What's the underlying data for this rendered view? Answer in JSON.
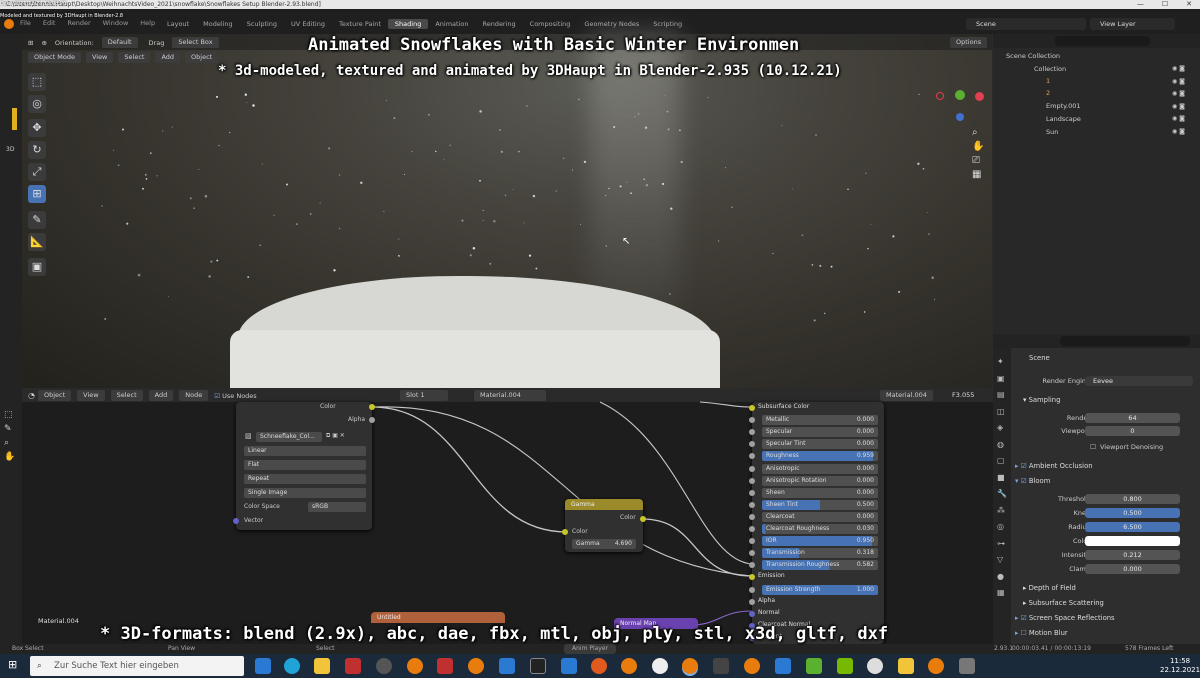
{
  "titlebar": {
    "line1": "Date 2021/12/22 13:08:20",
    "line2": "C:\\Users\\Dennis.Haupt\\Desktop\\WeihnachtsVideo_2021\\snowflake\\Snowflakes Setup Blender-2.93.blend]",
    "line3": "Modeled and textured by 3DHaupt in Blender-2.8"
  },
  "menubar": {
    "items": [
      "File",
      "Edit",
      "Render",
      "Window",
      "Help"
    ],
    "tabs": [
      "Layout",
      "Modeling",
      "Sculpting",
      "UV Editing",
      "Texture Paint",
      "Shading",
      "Animation",
      "Rendering",
      "Compositing",
      "Geometry Nodes",
      "Scripting"
    ],
    "active_tab": "Shading",
    "scene": "Scene",
    "view_layer": "View Layer"
  },
  "viewport": {
    "orientation_label": "Orientation:",
    "orientation": "Default",
    "drag_label": "Drag",
    "drag": "Select Box",
    "mode": "Object Mode",
    "menu": [
      "View",
      "Select",
      "Add",
      "Object"
    ],
    "options": "Options",
    "side_label": "3D"
  },
  "overlay": {
    "title": "Animated Snowflakes with Basic Winter Environmen",
    "subtitle": "* 3d-modeled, textured and animated by 3DHaupt in Blender-2.935 (10.12.21)",
    "formats": "* 3D-formats: blend (2.9x), abc, dae, fbx, mtl, obj, ply, stl, x3d, gltf, dxf"
  },
  "outliner": {
    "root": "Scene Collection",
    "items": [
      "Collection",
      "1",
      "2",
      "Empty.001",
      "Landscape",
      "Sun"
    ]
  },
  "properties": {
    "scene": "Scene",
    "render_engine_label": "Render Engine",
    "render_engine": "Eevee",
    "sampling": "Sampling",
    "render_label": "Render",
    "render_val": "64",
    "viewport_label": "Viewport",
    "viewport_val": "0",
    "denoise": "Viewport Denoising",
    "ao": "Ambient Occlusion",
    "bloom": "Bloom",
    "threshold_label": "Threshold",
    "threshold": "0.800",
    "knee_label": "Knee",
    "knee": "0.500",
    "radius_label": "Radius",
    "radius": "6.500",
    "color_label": "Color",
    "intensity_label": "Intensity",
    "intensity": "0.212",
    "clamp_label": "Clamp",
    "clamp": "0.000",
    "dof": "Depth of Field",
    "sss": "Subsurface Scattering",
    "ssr": "Screen Space Reflections",
    "motion_blur": "Motion Blur"
  },
  "node_editor": {
    "mode": "Object",
    "menu": [
      "View",
      "Select",
      "Add",
      "Node"
    ],
    "use_nodes": "Use Nodes",
    "slot": "Slot 1",
    "material": "Material.004",
    "frame": "F3.055",
    "material_label": "Material.004",
    "image_node": {
      "out_color": "Color",
      "out_alpha": "Alpha",
      "image": "Schneeflake_Col...",
      "interp": "Linear",
      "proj": "Flat",
      "ext": "Repeat",
      "source": "Single Image",
      "cs_label": "Color Space",
      "cs": "sRGB",
      "vector": "Vector"
    },
    "gamma_node": {
      "title": "Gamma",
      "out": "Color",
      "in": "Color",
      "gamma_label": "Gamma",
      "gamma": "4.690"
    },
    "untitled": "Untitled",
    "normal_map": "Normal Map",
    "bsdf": [
      [
        "Subsurface Color",
        ""
      ],
      [
        "Metallic",
        "0.000"
      ],
      [
        "Specular",
        "0.000"
      ],
      [
        "Specular Tint",
        "0.000"
      ],
      [
        "Roughness",
        "0.959"
      ],
      [
        "Anisotropic",
        "0.000"
      ],
      [
        "Anisotropic Rotation",
        "0.000"
      ],
      [
        "Sheen",
        "0.000"
      ],
      [
        "Sheen Tint",
        "0.500"
      ],
      [
        "Clearcoat",
        "0.000"
      ],
      [
        "Clearcoat Roughness",
        "0.030"
      ],
      [
        "IOR",
        "0.950"
      ],
      [
        "Transmission",
        "0.318"
      ],
      [
        "Transmission Roughness",
        "0.582"
      ],
      [
        "Emission",
        ""
      ],
      [
        "Emission Strength",
        "1.000"
      ],
      [
        "Alpha",
        ""
      ],
      [
        "Normal",
        ""
      ],
      [
        "Clearcoat Normal",
        ""
      ],
      [
        "Tangent",
        ""
      ]
    ]
  },
  "statusbar": {
    "left": "Box Select",
    "pan": "Pan View",
    "select": "Select",
    "anim": "Anim Player",
    "version": "2.93.1",
    "time": "00:00:03.41 / 00:00:13:19",
    "frames": "578 Frames Left"
  },
  "taskbar": {
    "search_placeholder": "Zur Suche Text hier eingeben",
    "clock_time": "11:58",
    "clock_date": "22.12.2021"
  }
}
